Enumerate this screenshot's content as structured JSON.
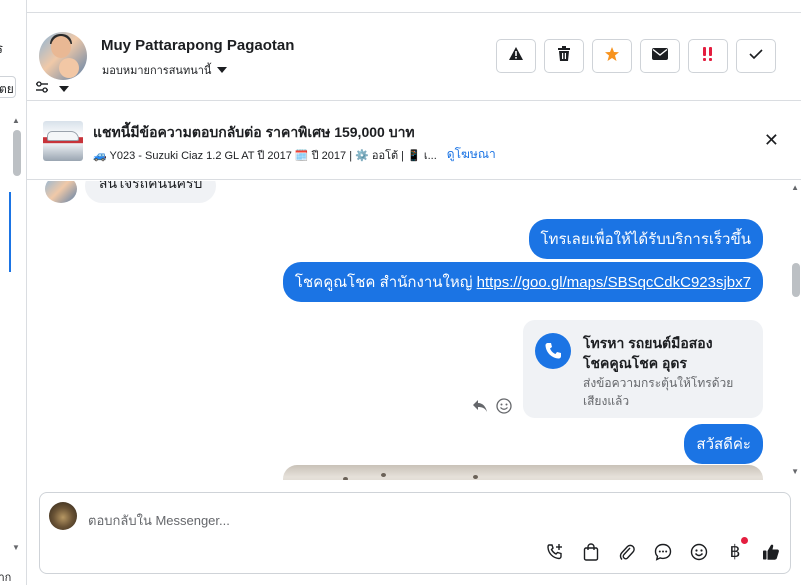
{
  "left_panel": {
    "fragment_top": "ร",
    "fragment_dropdown": "ตย",
    "fragment_bottom": "ฝาก"
  },
  "header": {
    "contact_name": "Muy Pattarapong Pagaotan",
    "assign_label": "มอบหมายการสนทนานี้",
    "toolbar": [
      {
        "name": "spam",
        "icon": "warning-triangle-icon"
      },
      {
        "name": "delete",
        "icon": "trash-icon"
      },
      {
        "name": "star",
        "icon": "star-icon",
        "color": "#f7931e"
      },
      {
        "name": "mark-unread",
        "icon": "envelope-icon"
      },
      {
        "name": "follow-up",
        "icon": "exclamation-icon",
        "color": "#e41e3f"
      },
      {
        "name": "done",
        "icon": "checkmark-icon"
      }
    ]
  },
  "ad": {
    "title": "แชทนี้มีข้อความตอบกลับต่อ ราคาพิเศษ 159,000 บาท",
    "details": "🚙 Y023 - Suzuki Ciaz 1.2 GL AT ปี 2017 🗓️ ปี 2017 | ⚙️ ออโต้ | 📱 เ...",
    "link": "ดูโฆษณา"
  },
  "messages": {
    "incoming_partial": "สนใจรถคันนี้ครับ",
    "out_1": "โทรเลยเพื่อให้ได้รับบริการเร็วขึ้น",
    "out_2_prefix": "โชคคูณโชค สำนักงานใหญ่ ",
    "out_2_link": "https://goo.gl/maps/SBSqcCdkC923sjbx7",
    "call_card": {
      "title_line1": "โทรหา รถยนต์มือสอง",
      "title_line2": "โชคคูณโชค อุดร",
      "sub_line1": "ส่งข้อความกระตุ้นให้โทรด้วย",
      "sub_line2": "เสียงแล้ว"
    },
    "out_3": "สวัสดีค่ะ"
  },
  "composer": {
    "placeholder": "ตอบกลับใน Messenger...",
    "currency_symbol": "฿",
    "tools": [
      "call-plus-icon",
      "shopping-bag-icon",
      "paperclip-icon",
      "chat-bubble-icon",
      "emoji-icon",
      "baht-icon",
      "thumbs-up-icon"
    ]
  },
  "colors": {
    "accent": "#1b74e4",
    "star": "#f7931e",
    "alert": "#e41e3f"
  }
}
